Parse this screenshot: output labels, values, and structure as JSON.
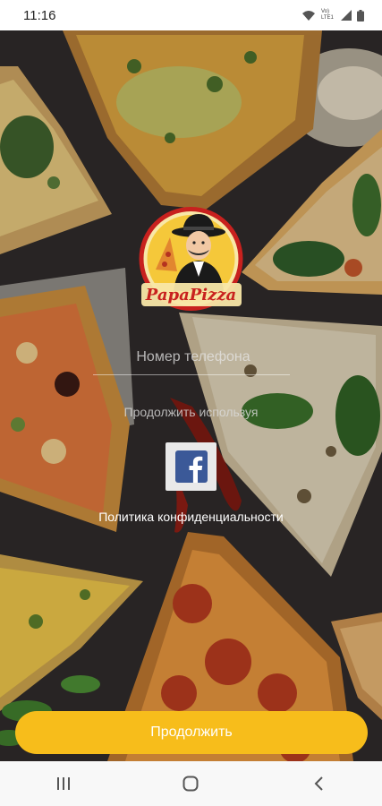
{
  "status_bar": {
    "time": "11:16",
    "network": "Vo) LTE1",
    "icons": [
      "wifi-icon",
      "signal-icon",
      "battery-icon"
    ]
  },
  "logo": {
    "brand": "PapaPizza"
  },
  "form": {
    "phone_placeholder": "Номер телефона",
    "continue_using": "Продолжить используя",
    "social_icon": "facebook-icon",
    "privacy_policy": "Политика конфиденциальности"
  },
  "primary_button": {
    "label": "Продолжить"
  },
  "nav_bar": {
    "icons": [
      "recent-apps-icon",
      "home-icon",
      "back-icon"
    ]
  },
  "colors": {
    "accent": "#f7bd1b",
    "facebook": "#3b5998"
  }
}
